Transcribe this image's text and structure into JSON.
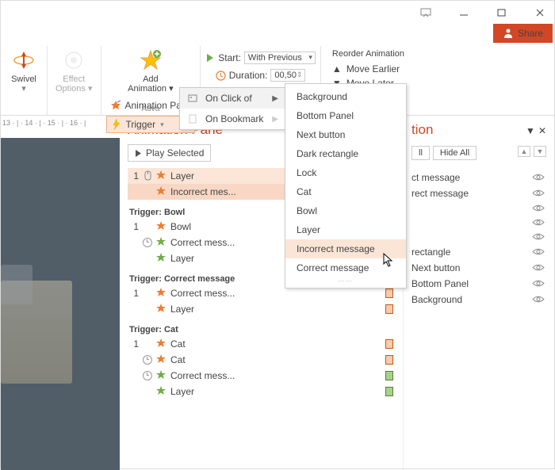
{
  "titlebar": {
    "share": "Share"
  },
  "ribbon": {
    "swivel": "Swivel",
    "effectOptions": "Effect\nOptions",
    "addAnimation": "Add\nAnimation",
    "animationPane": "Animation Pane",
    "trigger": "Trigger",
    "advancedGroup": "Adva",
    "startLabel": "Start:",
    "startValue": "With Previous",
    "durationLabel": "Duration:",
    "durationValue": "00,50",
    "reorderTitle": "Reorder Animation",
    "moveEarlier": "Move Earlier",
    "moveLater": "Move Later"
  },
  "triggerMenu": {
    "onClick": "On Click of",
    "onBookmark": "On Bookmark"
  },
  "clickMenu": {
    "items": [
      "Background",
      "Bottom Panel",
      "Next button",
      "Dark rectangle",
      "Lock",
      "Cat",
      "Bowl",
      "Layer",
      "Incorrect message",
      "Correct message"
    ]
  },
  "hruler": "13 · | · 14 · | · 15 · | · 16 · |",
  "animPane": {
    "title": "Animation Pane",
    "play": "Play Selected",
    "top": [
      {
        "n": "1",
        "pre": "mouse",
        "star": "o",
        "txt": "Layer",
        "bar": "#f4b183"
      },
      {
        "n": "",
        "pre": "",
        "star": "o",
        "txt": "Incorrect mes...",
        "bar": "#f4b183"
      }
    ],
    "groups": [
      {
        "title": "Trigger: Bowl",
        "items": [
          {
            "n": "1",
            "pre": "",
            "star": "o",
            "txt": "Bowl",
            "bar": "#f8cbad"
          },
          {
            "n": "",
            "pre": "clock",
            "star": "g",
            "txt": "Correct mess...",
            "bar": "#a9d08e"
          },
          {
            "n": "",
            "pre": "",
            "star": "g",
            "txt": "Layer",
            "bar": "#a9d08e"
          }
        ]
      },
      {
        "title": "Trigger: Correct message",
        "items": [
          {
            "n": "1",
            "pre": "",
            "star": "o",
            "txt": "Correct mess...",
            "bar": "#f8cbad"
          },
          {
            "n": "",
            "pre": "",
            "star": "o",
            "txt": "Layer",
            "bar": "#f8cbad"
          }
        ]
      },
      {
        "title": "Trigger: Cat",
        "items": [
          {
            "n": "1",
            "pre": "",
            "star": "o",
            "txt": "Cat",
            "bar": "#f8cbad"
          },
          {
            "n": "",
            "pre": "clock",
            "star": "o",
            "txt": "Cat",
            "bar": "#f8cbad"
          },
          {
            "n": "",
            "pre": "clock",
            "star": "g",
            "txt": "Correct mess...",
            "bar": "#a9d08e"
          },
          {
            "n": "",
            "pre": "",
            "star": "g",
            "txt": "Layer",
            "bar": "#a9d08e"
          }
        ]
      }
    ]
  },
  "selPane": {
    "title": "tion",
    "showAll": "ll",
    "hideAll": "Hide All",
    "items": [
      "ct message",
      "rect message",
      "",
      "",
      "",
      "rectangle",
      "Next button",
      "Bottom Panel",
      "Background"
    ]
  }
}
